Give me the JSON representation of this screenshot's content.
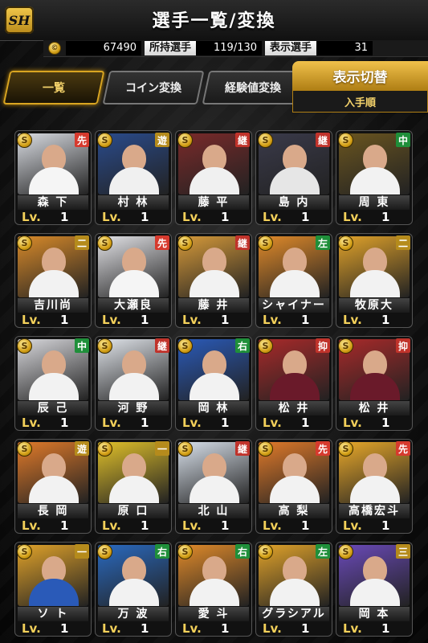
{
  "header": {
    "title": "選手一覧/変換",
    "logo": "SH"
  },
  "stats": {
    "coins": "67490",
    "owned_label": "所持選手",
    "owned_value": "119/130",
    "display_label": "表示選手",
    "display_value": "31"
  },
  "tabs": [
    {
      "label": "一覧",
      "active": true
    },
    {
      "label": "コイン変換",
      "active": false
    },
    {
      "label": "経験値変換",
      "active": false
    }
  ],
  "sort": {
    "button": "表示切替",
    "current": "入手順"
  },
  "colors": {
    "pos_starter": "#d63a2e",
    "pos_relief": "#1e9e3a",
    "pos_closer": "#c0332b",
    "pos_infield": "#b58b1c",
    "pos_outfield": "#1f8f3a",
    "pos_catcher": "#2b5fb8",
    "accent_gold": "#d9a521"
  },
  "players": [
    {
      "name": "森 下",
      "pos": "先",
      "lv": "Lv.",
      "lvnum": "1",
      "bg": "#d9dce2",
      "uni": "#f5f5f5"
    },
    {
      "name": "村 林",
      "pos": "遊",
      "lv": "Lv.",
      "lvnum": "1",
      "bg": "#2a4b8c",
      "uni": "#f0f0f0"
    },
    {
      "name": "藤 平",
      "pos": "継",
      "lv": "Lv.",
      "lvnum": "1",
      "bg": "#7a2a2a",
      "uni": "#f0f0f0"
    },
    {
      "name": "島 内",
      "pos": "継",
      "lv": "Lv.",
      "lvnum": "1",
      "bg": "#3a3a4a",
      "uni": "#e6e6e6"
    },
    {
      "name": "周 東",
      "pos": "中",
      "lv": "Lv.",
      "lvnum": "1",
      "bg": "#6a5520",
      "uni": "#f2f2f2"
    },
    {
      "name": "吉川尚",
      "pos": "二",
      "lv": "Lv.",
      "lvnum": "1",
      "bg": "#d88a2a",
      "uni": "#f2f2f2"
    },
    {
      "name": "大瀬良",
      "pos": "先",
      "lv": "Lv.",
      "lvnum": "1",
      "bg": "#e2e2e6",
      "uni": "#f5f5f5"
    },
    {
      "name": "藤 井",
      "pos": "継",
      "lv": "Lv.",
      "lvnum": "1",
      "bg": "#d69a3a",
      "uni": "#f2f2f2"
    },
    {
      "name": "シャイナー",
      "pos": "左",
      "lv": "Lv.",
      "lvnum": "1",
      "bg": "#e08a2a",
      "uni": "#f2f2f2"
    },
    {
      "name": "牧原大",
      "pos": "二",
      "lv": "Lv.",
      "lvnum": "1",
      "bg": "#e0a22a",
      "uni": "#f2f2f2"
    },
    {
      "name": "辰 己",
      "pos": "中",
      "lv": "Lv.",
      "lvnum": "1",
      "bg": "#d8d8dc",
      "uni": "#f2f2f2"
    },
    {
      "name": "河 野",
      "pos": "継",
      "lv": "Lv.",
      "lvnum": "1",
      "bg": "#e0e4ea",
      "uni": "#f2f2f2"
    },
    {
      "name": "岡 林",
      "pos": "右",
      "lv": "Lv.",
      "lvnum": "1",
      "bg": "#2a5ab8",
      "uni": "#f2f2f2"
    },
    {
      "name": "松 井",
      "pos": "抑",
      "lv": "Lv.",
      "lvnum": "1",
      "bg": "#a82a2a",
      "uni": "#6a1a2a"
    },
    {
      "name": "松 井",
      "pos": "抑",
      "lv": "Lv.",
      "lvnum": "1",
      "bg": "#a82a2a",
      "uni": "#6a1a2a"
    },
    {
      "name": "長 岡",
      "pos": "遊",
      "lv": "Lv.",
      "lvnum": "1",
      "bg": "#e07a2a",
      "uni": "#f2f2f2"
    },
    {
      "name": "原 口",
      "pos": "一",
      "lv": "Lv.",
      "lvnum": "1",
      "bg": "#e0c02a",
      "uni": "#f2f2f2"
    },
    {
      "name": "北 山",
      "pos": "継",
      "lv": "Lv.",
      "lvnum": "1",
      "bg": "#d8e0ea",
      "uni": "#f2f2f2"
    },
    {
      "name": "高 梨",
      "pos": "先",
      "lv": "Lv.",
      "lvnum": "1",
      "bg": "#e07a2a",
      "uni": "#f2f2f2"
    },
    {
      "name": "高橋宏斗",
      "pos": "先",
      "lv": "Lv.",
      "lvnum": "1",
      "bg": "#e8a82a",
      "uni": "#f2f2f2"
    },
    {
      "name": "ソ ト",
      "pos": "一",
      "lv": "Lv.",
      "lvnum": "1",
      "bg": "#e0a22a",
      "uni": "#2a5ab8"
    },
    {
      "name": "万 波",
      "pos": "右",
      "lv": "Lv.",
      "lvnum": "1",
      "bg": "#2a6ac0",
      "uni": "#f2f2f2"
    },
    {
      "name": "愛 斗",
      "pos": "右",
      "lv": "Lv.",
      "lvnum": "1",
      "bg": "#e08a2a",
      "uni": "#f2f2f2"
    },
    {
      "name": "グラシアル",
      "pos": "左",
      "lv": "Lv.",
      "lvnum": "1",
      "bg": "#e0a22a",
      "uni": "#f2f2f2"
    },
    {
      "name": "岡 本",
      "pos": "三",
      "lv": "Lv.",
      "lvnum": "1",
      "bg": "#6a4ab8",
      "uni": "#f2f2f2"
    }
  ]
}
